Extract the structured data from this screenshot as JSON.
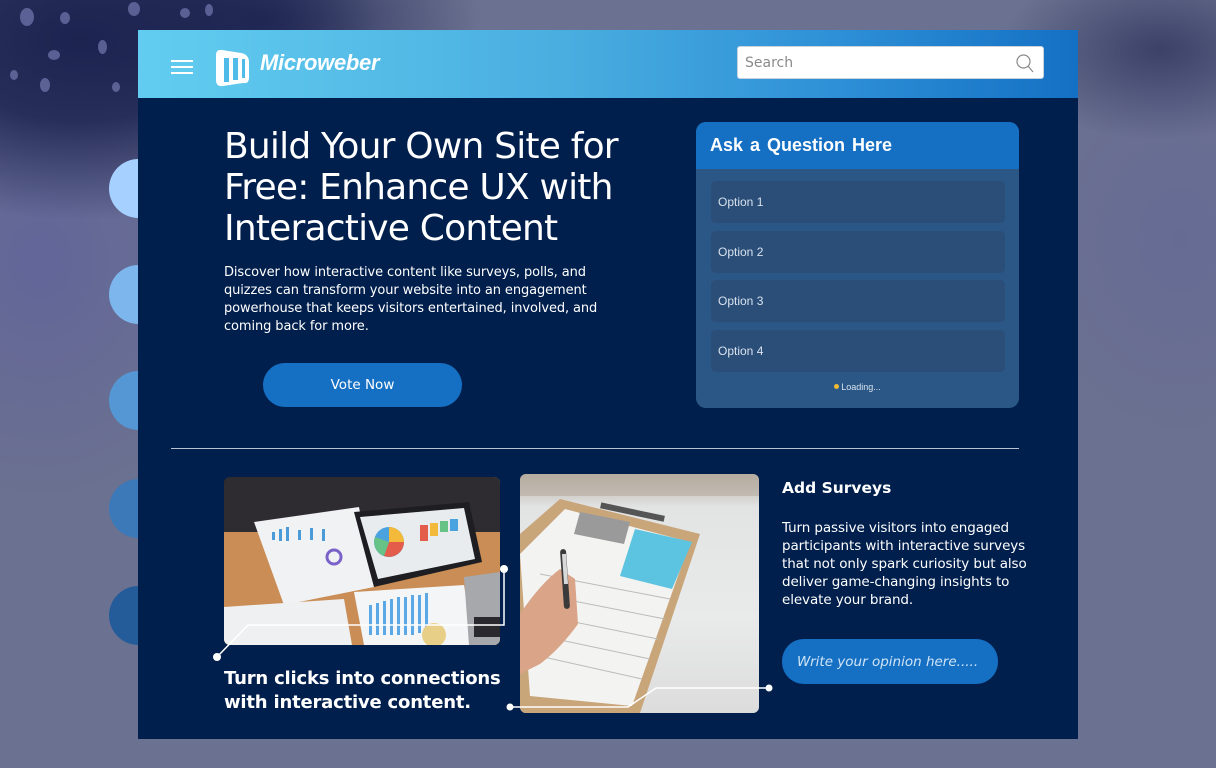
{
  "header": {
    "brand": "Microweber",
    "search_placeholder": "Search"
  },
  "hero": {
    "title": "Build Your Own Site for Free: Enhance UX with Interactive Content",
    "description": "Discover how interactive content like surveys, polls, and quizzes can transform your website into an engagement powerhouse that keeps visitors entertained, involved, and coming back for more.",
    "cta_label": "Vote Now"
  },
  "poll": {
    "title": "Ask  a Question Here",
    "options": [
      {
        "label": "Option 1"
      },
      {
        "label": "Option 2"
      },
      {
        "label": "Option 3"
      },
      {
        "label": "Option 4"
      }
    ],
    "status": "Loading..."
  },
  "features": {
    "caption": "Turn clicks into connections with interactive content.",
    "surveys_title": "Add Surveys",
    "surveys_description": "Turn passive visitors into engaged participants with interactive surveys that not only spark curiosity but also deliver game-changing insights to elevate your brand.",
    "opinion_placeholder": "Write your opinion here.....",
    "photo1_alt": "Business charts and tablet on desk",
    "photo2_alt": "Hand filling out a form on a clipboard"
  },
  "colors": {
    "frame_bg": "#001f4d",
    "accent": "#1570c4",
    "poll_card": "#2a5785",
    "poll_option": "#2a4e78",
    "loading_dot": "#f2b933",
    "side_dots": [
      "#a6d0ff",
      "#7db6ec",
      "#5597d4",
      "#3b79b8",
      "#245c9a"
    ]
  }
}
